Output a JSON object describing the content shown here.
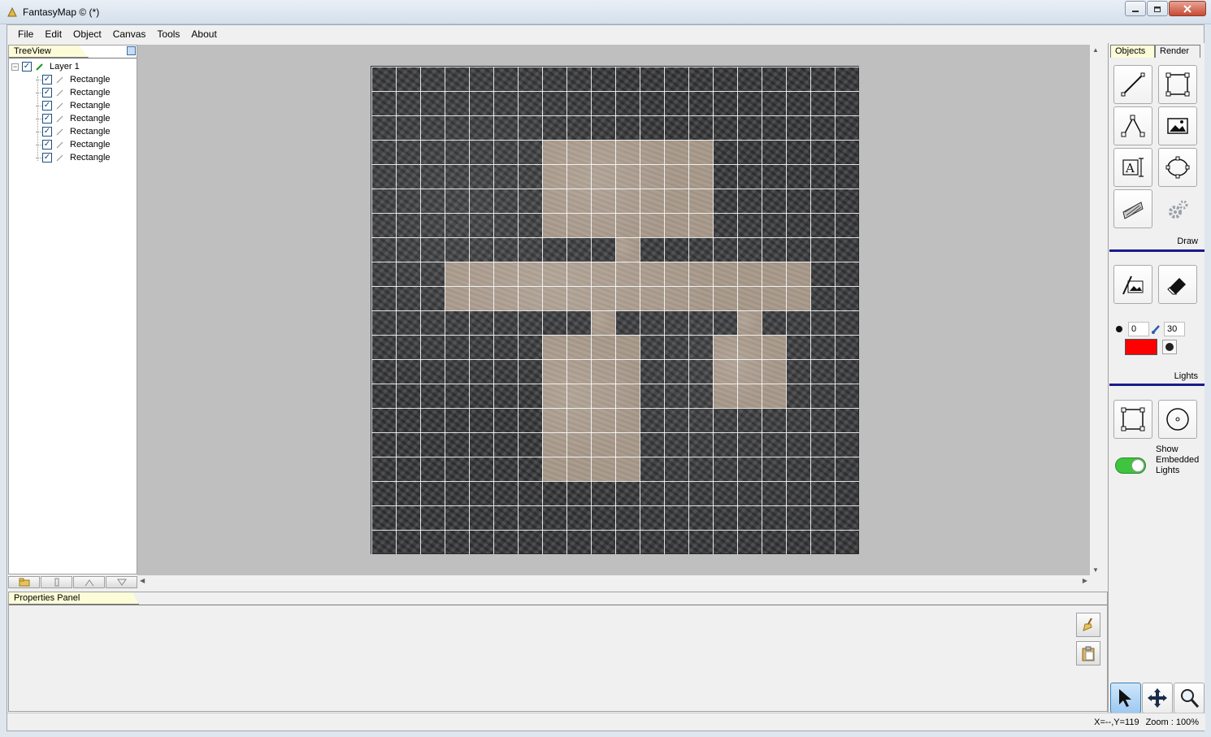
{
  "window": {
    "title": "FantasyMap © (*)"
  },
  "menu": [
    "File",
    "Edit",
    "Object",
    "Canvas",
    "Tools",
    "About"
  ],
  "tree": {
    "tab_label": "TreeView",
    "layer": {
      "label": "Layer 1",
      "checked": true
    },
    "items": [
      {
        "label": "Rectangle"
      },
      {
        "label": "Rectangle"
      },
      {
        "label": "Rectangle"
      },
      {
        "label": "Rectangle"
      },
      {
        "label": "Rectangle"
      },
      {
        "label": "Rectangle"
      },
      {
        "label": "Rectangle"
      }
    ]
  },
  "properties": {
    "tab_label": "Properties Panel"
  },
  "right_panel": {
    "tabs": [
      "Objects",
      "Render"
    ],
    "active_tab": "Objects",
    "draw_label": "Draw",
    "lights_label": "Lights",
    "brush_size": "0",
    "brush_width": "30",
    "light_color": "#ff0000",
    "show_embedded_lights": "Show Embedded Lights",
    "show_embedded_lights_on": true
  },
  "map": {
    "grid_cols": 20,
    "grid_rows": 20,
    "stone_color": "#3d3e40",
    "floor_color": "#a8998a"
  },
  "status": {
    "coords": "X=--,Y=119",
    "zoom": "Zoom : 100%"
  }
}
